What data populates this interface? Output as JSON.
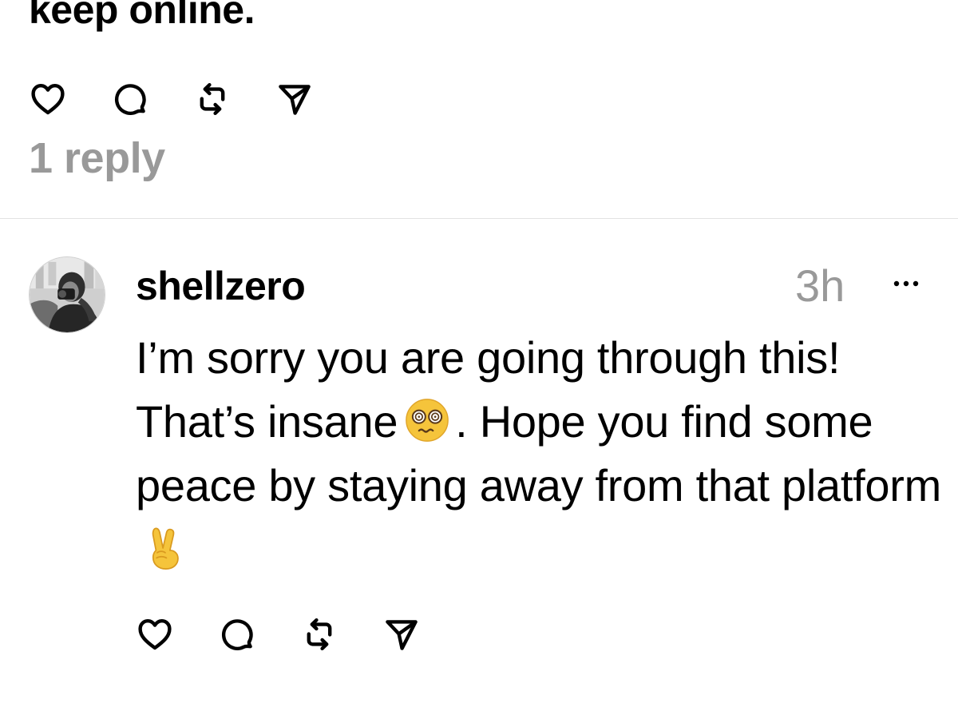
{
  "previous_post": {
    "text_tail": "keep online.",
    "reply_count": "1 reply"
  },
  "reply": {
    "username": "shellzero",
    "timestamp": "3h",
    "text_part1": "I’m sorry you are going through this! That’s insane",
    "emoji_1": "face-with-spiral-eyes",
    "text_part2": ". Hope you find some peace by staying away from that platform",
    "emoji_2": "victory-hand"
  },
  "icons": {
    "like": "heart-icon",
    "comment": "comment-icon",
    "repost": "repost-icon",
    "share": "send-icon",
    "more": "more-icon"
  },
  "colors": {
    "text": "#000000",
    "muted": "#999999",
    "divider": "#e3e3e3",
    "emoji_yellow": "#f5c43b"
  }
}
